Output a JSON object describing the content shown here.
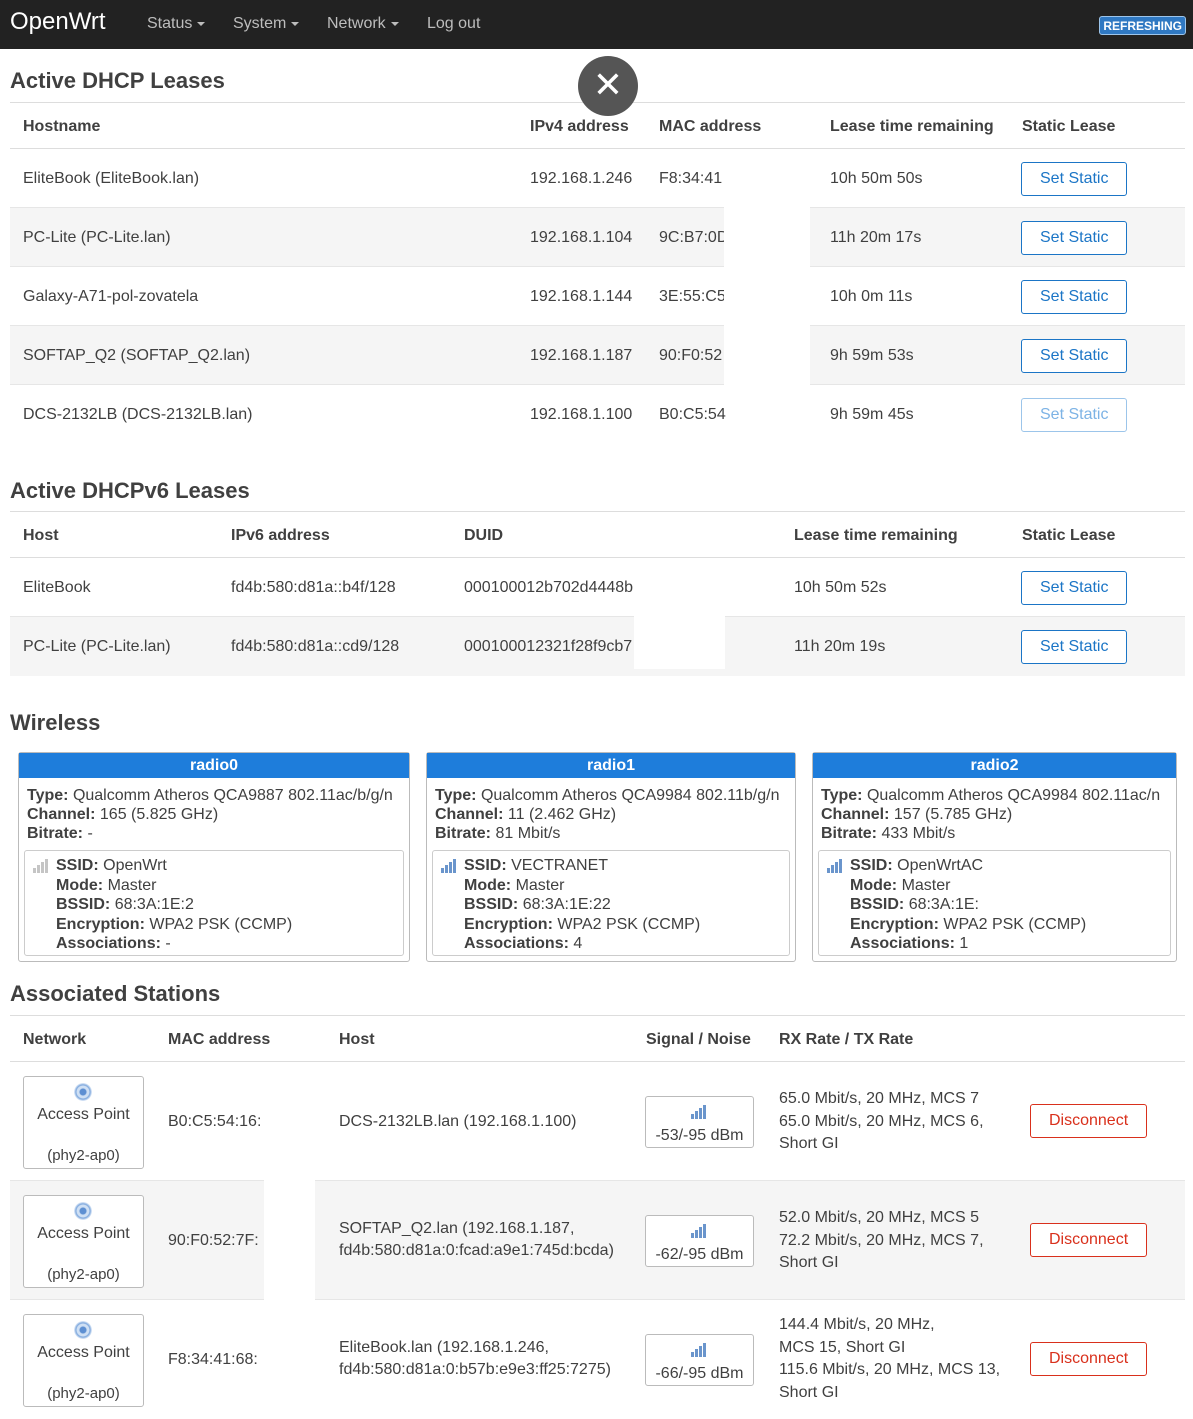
{
  "navbar": {
    "brand": "OpenWrt",
    "menus": [
      "Status",
      "System",
      "Network"
    ],
    "logout": "Log out",
    "refresh_badge": "REFRESHING"
  },
  "overlay": {
    "close_glyph": "✕"
  },
  "dhcp": {
    "title": "Active DHCP Leases",
    "headers": [
      "Hostname",
      "IPv4 address",
      "MAC address",
      "Lease time remaining",
      "Static Lease"
    ],
    "rows": [
      {
        "hostname": "EliteBook (EliteBook.lan)",
        "ipv4": "192.168.1.246",
        "mac": "F8:34:41",
        "lease": "10h 50m 50s",
        "button": "Set Static"
      },
      {
        "hostname": "PC-Lite (PC-Lite.lan)",
        "ipv4": "192.168.1.104",
        "mac": "9C:B7:0D",
        "lease": "11h 20m 17s",
        "button": "Set Static"
      },
      {
        "hostname": "Galaxy-A71-pol-zovatela",
        "ipv4": "192.168.1.144",
        "mac": "3E:55:C5",
        "lease": "10h 0m 11s",
        "button": "Set Static"
      },
      {
        "hostname": "SOFTAP_Q2 (SOFTAP_Q2.lan)",
        "ipv4": "192.168.1.187",
        "mac": "90:F0:52",
        "lease": "9h 59m 53s",
        "button": "Set Static"
      },
      {
        "hostname": "DCS-2132LB (DCS-2132LB.lan)",
        "ipv4": "192.168.1.100",
        "mac": "B0:C5:54",
        "lease": "9h 59m 45s",
        "button": "Set Static"
      }
    ]
  },
  "dhcpv6": {
    "title": "Active DHCPv6 Leases",
    "headers": [
      "Host",
      "IPv6 address",
      "DUID",
      "Lease time remaining",
      "Static Lease"
    ],
    "rows": [
      {
        "host": "EliteBook",
        "ipv6": "fd4b:580:d81a::b4f/128",
        "duid": "000100012b702d4448b",
        "lease": "10h 50m 52s",
        "button": "Set Static"
      },
      {
        "host": "PC-Lite (PC-Lite.lan)",
        "ipv6": "fd4b:580:d81a::cd9/128",
        "duid": "000100012321f28f9cb7",
        "lease": "11h 20m 19s",
        "button": "Set Static"
      }
    ]
  },
  "wireless": {
    "title": "Wireless",
    "labels": {
      "type": "Type:",
      "channel": "Channel:",
      "bitrate": "Bitrate:",
      "ssid": "SSID:",
      "mode": "Mode:",
      "bssid": "BSSID:",
      "encryption": "Encryption:",
      "associations": "Associations:"
    },
    "radios": [
      {
        "name": "radio0",
        "type": "Qualcomm Atheros QCA9887 802.11ac/b/g/n",
        "channel": "165 (5.825 GHz)",
        "bitrate": "-",
        "ssid": "OpenWrt",
        "mode": "Master",
        "bssid": "68:3A:1E:2",
        "encryption": "WPA2 PSK (CCMP)",
        "associations": "-",
        "signal_icon": "signal-off-icon"
      },
      {
        "name": "radio1",
        "type": "Qualcomm Atheros QCA9984 802.11b/g/n",
        "channel": "11 (2.462 GHz)",
        "bitrate": "81 Mbit/s",
        "ssid": "VECTRANET",
        "mode": "Master",
        "bssid": "68:3A:1E:22",
        "encryption": "WPA2 PSK (CCMP)",
        "associations": "4",
        "signal_icon": "signal-on-icon"
      },
      {
        "name": "radio2",
        "type": "Qualcomm Atheros QCA9984 802.11ac/n",
        "channel": "157 (5.785 GHz)",
        "bitrate": "433 Mbit/s",
        "ssid": "OpenWrtAC",
        "mode": "Master",
        "bssid": "68:3A:1E:",
        "encryption": "WPA2 PSK (CCMP)",
        "associations": "1",
        "signal_icon": "signal-on-icon"
      }
    ]
  },
  "stations": {
    "title": "Associated Stations",
    "headers": [
      "Network",
      "MAC address",
      "Host",
      "Signal / Noise",
      "RX Rate / TX Rate"
    ],
    "rows": [
      {
        "network": "Access Point",
        "iface": "(phy2-ap0)",
        "mac": "B0:C5:54:16:",
        "host": [
          "DCS-2132LB.lan (192.168.1.100)"
        ],
        "signal": "-53/-95 dBm",
        "rate": [
          "65.0 Mbit/s, 20 MHz, MCS 7",
          "65.0 Mbit/s, 20 MHz, MCS 6,",
          "Short GI"
        ],
        "button": "Disconnect"
      },
      {
        "network": "Access Point",
        "iface": "(phy2-ap0)",
        "mac": "90:F0:52:7F:",
        "host": [
          "SOFTAP_Q2.lan (192.168.1.187,",
          "fd4b:580:d81a:0:fcad:a9e1:745d:bcda)"
        ],
        "signal": "-62/-95 dBm",
        "rate": [
          "52.0 Mbit/s, 20 MHz, MCS 5",
          "72.2 Mbit/s, 20 MHz, MCS 7,",
          "Short GI"
        ],
        "button": "Disconnect"
      },
      {
        "network": "Access Point",
        "iface": "(phy2-ap0)",
        "mac": "F8:34:41:68:",
        "host": [
          "EliteBook.lan (192.168.1.246,",
          "fd4b:580:d81a:0:b57b:e9e3:ff25:7275)"
        ],
        "signal": "-66/-95 dBm",
        "rate": [
          "144.4 Mbit/s, 20 MHz,",
          "MCS 15, Short GI",
          "115.6 Mbit/s, 20 MHz, MCS 13,",
          "Short GI"
        ],
        "button": "Disconnect"
      }
    ]
  }
}
